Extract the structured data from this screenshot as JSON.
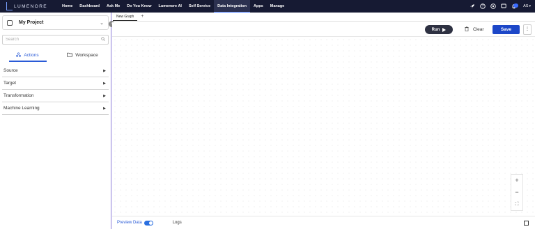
{
  "brand": {
    "name": "LUMENORE",
    "tagline": ""
  },
  "nav": {
    "items": [
      {
        "label": "Home",
        "active": false
      },
      {
        "label": "Dashboard",
        "active": false
      },
      {
        "label": "Ask Me",
        "active": false
      },
      {
        "label": "Do You Know",
        "active": false
      },
      {
        "label": "Lumenore AI",
        "active": false
      },
      {
        "label": "Self Service",
        "active": false
      },
      {
        "label": "Data Integration",
        "active": true
      },
      {
        "label": "Apps",
        "active": false
      },
      {
        "label": "Manage",
        "active": false
      }
    ],
    "icons": [
      "rocket-icon",
      "help-icon",
      "chat-icon",
      "message-icon",
      "notification-icon"
    ],
    "user_initials": "AS"
  },
  "sidebar": {
    "project_title": "My Project",
    "search_placeholder": "Search",
    "tabs": [
      {
        "label": "Actions",
        "icon": "actions-icon",
        "active": true
      },
      {
        "label": "Workspace",
        "icon": "folder-icon",
        "active": false
      }
    ],
    "sections": [
      {
        "label": "Source"
      },
      {
        "label": "Target"
      },
      {
        "label": "Transformation"
      },
      {
        "label": "Machine Learning"
      }
    ]
  },
  "workspace": {
    "graph_tab": "New Graph",
    "add_tab": "+",
    "toolbar": {
      "run_label": "Run",
      "clear_label": "Clear",
      "save_label": "Save",
      "more_label": "⋮"
    },
    "zoom": {
      "in": "+",
      "out": "−",
      "fit": "⛶"
    },
    "bottom": {
      "preview_label": "Preview Data",
      "preview_on": true,
      "logs_label": "Logs"
    }
  },
  "colors": {
    "nav_bg": "#161a33",
    "accent": "#1d47c8",
    "link": "#2a5bd7",
    "panel_border": "#8b7cd8"
  }
}
